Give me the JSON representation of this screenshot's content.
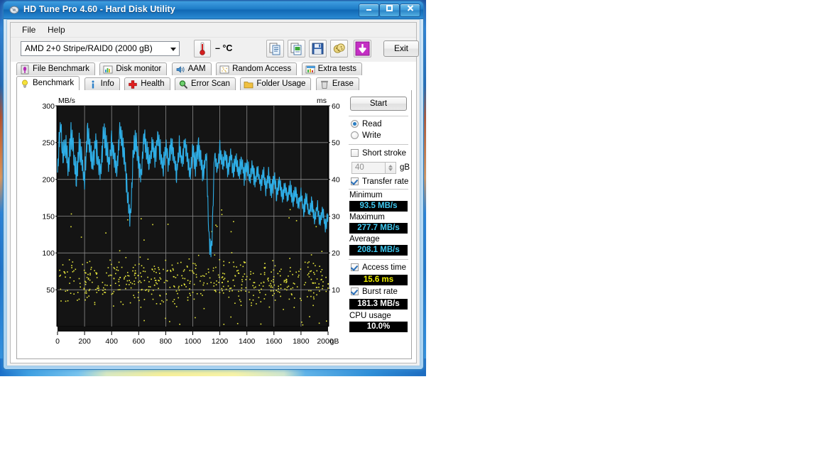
{
  "window": {
    "title": "HD Tune Pro 4.60 - Hard Disk Utility",
    "minimize_label": "Minimize",
    "maximize_label": "Maximize",
    "close_label": "Close"
  },
  "menu": {
    "items": [
      "File",
      "Help"
    ]
  },
  "toolbar": {
    "drive": "AMD    2+0 Stripe/RAID0 (2000 gB)",
    "temperature": "– °C",
    "exit_label": "Exit",
    "icons": [
      "temperature-icon",
      "copy-icon",
      "copy-image-icon",
      "save-icon",
      "cookie-icon",
      "download-icon"
    ]
  },
  "tabs": {
    "row1": [
      {
        "label": "File Benchmark",
        "icon": "file-benchmark-icon",
        "active": false
      },
      {
        "label": "Disk monitor",
        "icon": "disk-monitor-icon",
        "active": false
      },
      {
        "label": "AAM",
        "icon": "speaker-icon",
        "active": false
      },
      {
        "label": "Random Access",
        "icon": "random-access-icon",
        "active": false
      },
      {
        "label": "Extra tests",
        "icon": "extra-tests-icon",
        "active": false
      }
    ],
    "row2": [
      {
        "label": "Benchmark",
        "icon": "lightbulb-icon",
        "active": true
      },
      {
        "label": "Info",
        "icon": "info-icon",
        "active": false
      },
      {
        "label": "Health",
        "icon": "health-cross-icon",
        "active": false
      },
      {
        "label": "Error Scan",
        "icon": "magnifier-icon",
        "active": false
      },
      {
        "label": "Folder Usage",
        "icon": "folder-icon",
        "active": false
      },
      {
        "label": "Erase",
        "icon": "trash-icon",
        "active": false
      }
    ]
  },
  "controls": {
    "start_label": "Start",
    "mode": {
      "read": "Read",
      "write": "Write",
      "selected": "Read"
    },
    "short_stroke": {
      "label": "Short stroke",
      "checked": false,
      "value": "40",
      "unit": "gB"
    },
    "transfer_rate": {
      "label": "Transfer rate",
      "checked": true
    },
    "access_time": {
      "label": "Access time",
      "checked": true
    },
    "burst_rate": {
      "label": "Burst rate",
      "checked": true
    },
    "cpu_usage": {
      "label": "CPU usage"
    }
  },
  "results": {
    "minimum_label": "Minimum",
    "minimum_value": "93.5 MB/s",
    "maximum_label": "Maximum",
    "maximum_value": "277.7 MB/s",
    "average_label": "Average",
    "average_value": "208.1 MB/s",
    "access_time_value": "15.6 ms",
    "burst_rate_value": "181.3 MB/s",
    "cpu_usage_value": "10.0%"
  },
  "colors": {
    "transfer_line": "#2eaee6",
    "access_points": "#e8e83c",
    "plot_bg": "#141414",
    "grid": "#8a8a8a",
    "accent_blue": "#1d7cc6"
  },
  "chart_data": {
    "type": "line",
    "title": "",
    "xlabel": "gB",
    "ylabel": "MB/s",
    "y2label": "ms",
    "xlim": [
      0,
      2000
    ],
    "ylim": [
      0,
      300
    ],
    "y2lim": [
      0,
      60
    ],
    "xticks": [
      0,
      200,
      400,
      600,
      800,
      1000,
      1200,
      1400,
      1600,
      1800,
      2000
    ],
    "yticks": [
      50,
      100,
      150,
      200,
      250,
      300
    ],
    "y2ticks": [
      10,
      20,
      30,
      40,
      50,
      60
    ],
    "grid": true,
    "legend": "none",
    "series": [
      {
        "name": "Transfer rate",
        "unit": "MB/s",
        "axis": "left",
        "color": "#2eaee6",
        "summary": {
          "minimum": 93.5,
          "maximum": 277.7,
          "average": 208.1
        },
        "x": [
          0,
          20,
          40,
          60,
          80,
          100,
          120,
          140,
          160,
          180,
          200,
          220,
          240,
          260,
          280,
          300,
          320,
          340,
          360,
          380,
          400,
          420,
          440,
          460,
          480,
          500,
          520,
          540,
          560,
          580,
          600,
          620,
          640,
          660,
          680,
          700,
          720,
          740,
          760,
          780,
          800,
          820,
          840,
          860,
          880,
          900,
          920,
          940,
          960,
          980,
          1000,
          1020,
          1040,
          1060,
          1080,
          1100,
          1120,
          1140,
          1160,
          1180,
          1200,
          1220,
          1240,
          1260,
          1280,
          1300,
          1320,
          1340,
          1360,
          1380,
          1400,
          1420,
          1440,
          1460,
          1480,
          1500,
          1520,
          1540,
          1560,
          1580,
          1600,
          1620,
          1640,
          1660,
          1680,
          1700,
          1720,
          1740,
          1760,
          1780,
          1800,
          1820,
          1840,
          1860,
          1880,
          1900,
          1920,
          1940,
          1960,
          1980,
          2000
        ],
        "y": [
          205,
          277,
          230,
          248,
          215,
          262,
          234,
          200,
          248,
          226,
          195,
          268,
          240,
          218,
          250,
          228,
          205,
          266,
          243,
          220,
          255,
          232,
          210,
          268,
          246,
          222,
          172,
          147,
          238,
          252,
          228,
          205,
          262,
          240,
          216,
          250,
          230,
          258,
          236,
          212,
          246,
          224,
          252,
          230,
          208,
          244,
          222,
          250,
          228,
          206,
          240,
          220,
          248,
          226,
          204,
          236,
          118,
          100,
          232,
          212,
          240,
          218,
          238,
          216,
          234,
          212,
          230,
          208,
          226,
          205,
          222,
          200,
          218,
          196,
          214,
          193,
          210,
          188,
          206,
          185,
          202,
          180,
          198,
          176,
          194,
          172,
          190,
          168,
          186,
          164,
          180,
          158,
          175,
          152,
          170,
          146,
          165,
          140,
          160,
          134,
          152
        ]
      },
      {
        "name": "Access time",
        "unit": "ms",
        "axis": "right",
        "color": "#e8e83c",
        "style": "scatter",
        "summary": {
          "average": 15.6
        },
        "cluster_range_ms": [
          3,
          22
        ],
        "typical_ms": 15.6
      }
    ]
  }
}
